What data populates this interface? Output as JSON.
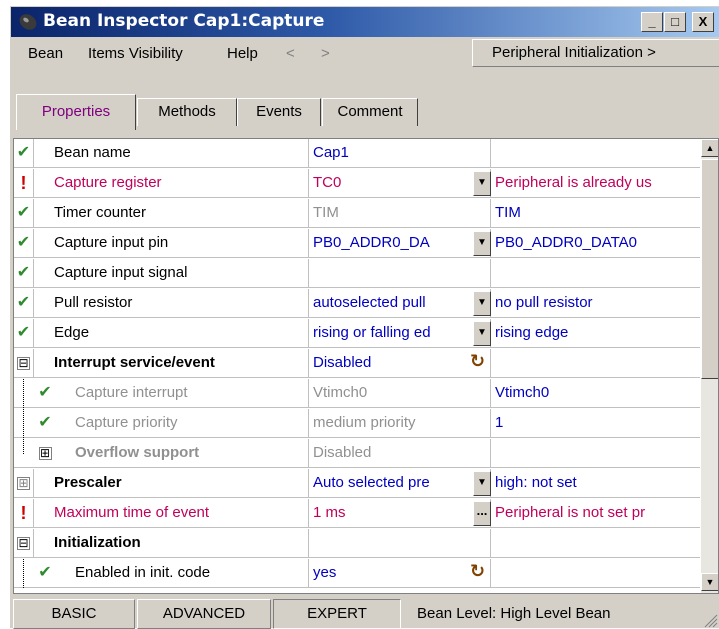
{
  "window": {
    "title": "Bean Inspector Cap1:Capture",
    "btn_min": "_",
    "btn_max": "□",
    "btn_close": "X"
  },
  "menu": {
    "bean": "Bean",
    "items_visibility": "Items Visibility",
    "help": "Help",
    "left_arrow": "<",
    "right_arrow": ">",
    "peripheral_init": "Peripheral Initialization >"
  },
  "tabs": {
    "properties": "Properties",
    "methods": "Methods",
    "events": "Events",
    "comment": "Comment"
  },
  "rows": [
    {
      "icon": "✔",
      "name": "Bean name",
      "value": "Cap1",
      "info": ""
    },
    {
      "icon": "!",
      "name": "Capture register",
      "value": "TC0",
      "info": "Peripheral is already us"
    },
    {
      "icon": "✔",
      "name": "Timer counter",
      "value": "TIM",
      "info": "TIM"
    },
    {
      "icon": "✔",
      "name": "Capture input pin",
      "value": "PB0_ADDR0_DA",
      "info": "PB0_ADDR0_DATA0"
    },
    {
      "icon": "✔",
      "name": "Capture input signal",
      "value": "",
      "info": ""
    },
    {
      "icon": "✔",
      "name": "Pull resistor",
      "value": "autoselected pull",
      "info": "no pull resistor"
    },
    {
      "icon": "✔",
      "name": "Edge",
      "value": "rising or falling ed",
      "info": "rising edge"
    },
    {
      "icon": "⊟",
      "name": "Interrupt service/event",
      "value": "Disabled",
      "info": ""
    },
    {
      "icon": "✔",
      "name": "Capture interrupt",
      "value": "Vtimch0",
      "info": "Vtimch0"
    },
    {
      "icon": "✔",
      "name": "Capture priority",
      "value": "medium priority",
      "info": "1"
    },
    {
      "icon": "⊞",
      "name": "Overflow support",
      "value": "Disabled",
      "info": ""
    },
    {
      "icon": "⊞",
      "name": "Prescaler",
      "value": "Auto selected pre",
      "info": "high: not set"
    },
    {
      "icon": "!",
      "name": "Maximum time of event",
      "value": "1 ms",
      "info": "Peripheral is not set pr"
    },
    {
      "icon": "⊟",
      "name": "Initialization",
      "value": "",
      "info": ""
    },
    {
      "icon": "✔",
      "name": "Enabled in init. code",
      "value": "yes",
      "info": ""
    }
  ],
  "status": {
    "basic": "BASIC",
    "advanced": "ADVANCED",
    "expert": "EXPERT",
    "bean_level": "Bean Level: High Level Bean"
  },
  "colors": {
    "titlebar_start": "#0a246a",
    "error_text": "#c0005a",
    "check_green": "#2e8b2e",
    "link_blue": "#0000c0"
  }
}
